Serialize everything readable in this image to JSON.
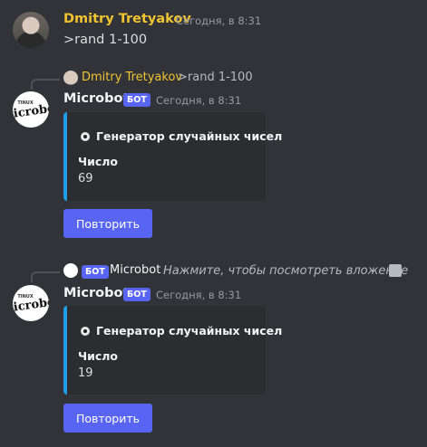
{
  "messages": [
    {
      "author": "Dmitry Tretyakov",
      "timestamp": "Сегодня, в 8:31",
      "text": ">rand 1-100"
    },
    {
      "reply": {
        "author": "Dmitry Tretyakov",
        "text": ">rand 1-100"
      },
      "author": "Microbot",
      "badge": "БОТ",
      "timestamp": "Сегодня, в 8:31",
      "embed": {
        "title": "Генератор случайных чисел",
        "field_name": "Число",
        "field_value": "69"
      },
      "button_label": "Повторить"
    },
    {
      "reply": {
        "badge": "БОТ",
        "author": "Microbot",
        "text": "Нажмите, чтобы посмотреть вложение"
      },
      "author": "Microbot",
      "badge": "БОТ",
      "timestamp": "Сегодня, в 8:31",
      "embed": {
        "title": "Генератор случайных чисел",
        "field_name": "Число",
        "field_value": "19"
      },
      "button_label": "Повторить"
    }
  ],
  "avatar_bot_logo_small": "TINUX",
  "avatar_bot_logo_big": "microbot",
  "colors": {
    "background": "#313338",
    "username_user": "#f0c331",
    "accent": "#5865f2",
    "embed_bar": "#1e9ee6"
  }
}
